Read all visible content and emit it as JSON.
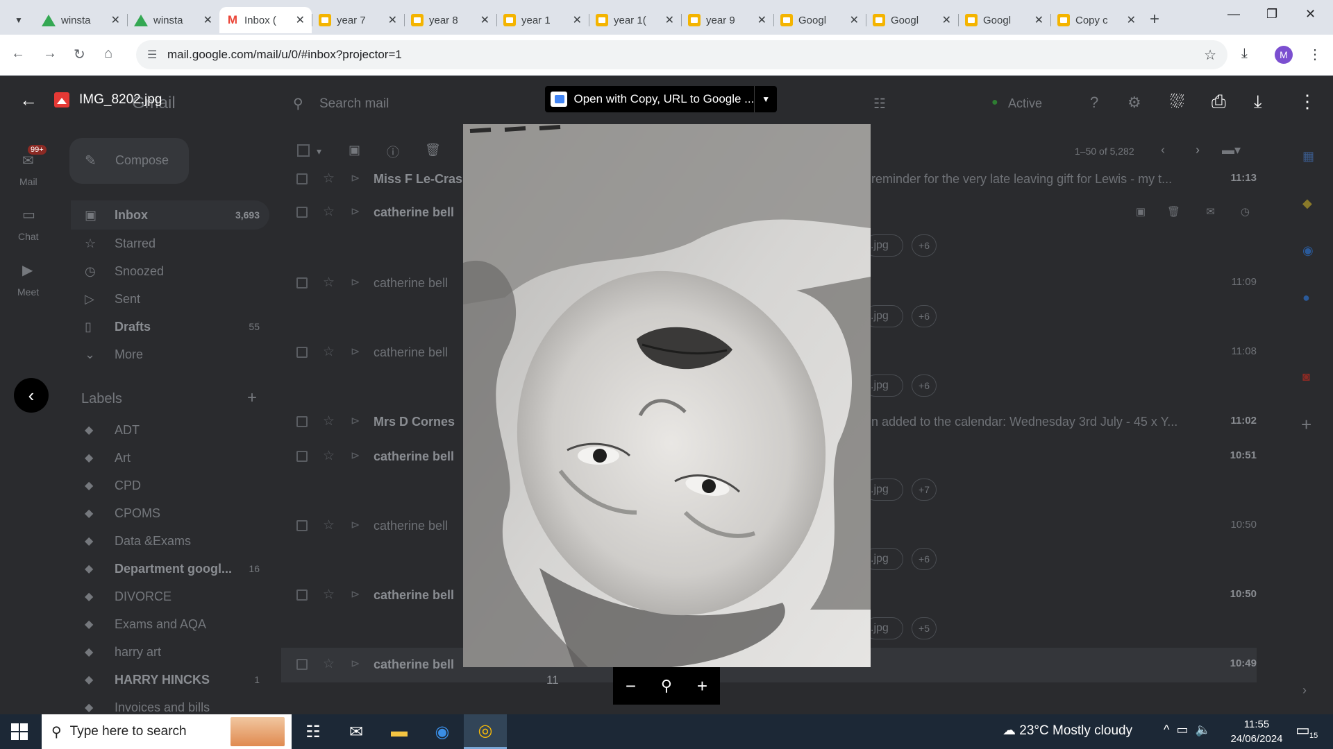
{
  "browser": {
    "tabs": [
      {
        "label": "winsta",
        "icon": "drive-icon",
        "active": false
      },
      {
        "label": "winsta",
        "icon": "drive-icon",
        "active": false
      },
      {
        "label": "Inbox (",
        "icon": "gmail-icon",
        "active": true
      },
      {
        "label": "year 7",
        "icon": "slides-icon",
        "active": false
      },
      {
        "label": "year 8",
        "icon": "slides-icon",
        "active": false
      },
      {
        "label": "year 1",
        "icon": "slides-icon",
        "active": false
      },
      {
        "label": "year 1(",
        "icon": "slides-icon",
        "active": false
      },
      {
        "label": "year 9",
        "icon": "slides-icon",
        "active": false
      },
      {
        "label": "Googl",
        "icon": "slides-icon",
        "active": false
      },
      {
        "label": "Googl",
        "icon": "slides-icon",
        "active": false
      },
      {
        "label": "Googl",
        "icon": "slides-icon",
        "active": false
      },
      {
        "label": "Copy c",
        "icon": "slides-icon",
        "active": false
      }
    ],
    "url": "mail.google.com/mail/u/0/#inbox?projector=1",
    "profile_initial": "M"
  },
  "viewer": {
    "file_name": "IMG_8202.jpg",
    "open_with_label": "Open with Copy, URL to Google ...",
    "page_number": "11"
  },
  "gmail": {
    "logo": "Gmail",
    "search_placeholder": "Search mail",
    "status": "Active",
    "pagination": "1–50 of 5,282",
    "compose": "Compose",
    "rail": [
      {
        "label": "Mail",
        "badge": "99+"
      },
      {
        "label": "Chat"
      },
      {
        "label": "Meet"
      }
    ],
    "nav": [
      {
        "label": "Inbox",
        "count": "3,693"
      },
      {
        "label": "Starred",
        "count": ""
      },
      {
        "label": "Snoozed",
        "count": ""
      },
      {
        "label": "Sent",
        "count": ""
      },
      {
        "label": "Drafts",
        "count": "55"
      },
      {
        "label": "More",
        "count": ""
      }
    ],
    "labels_header": "Labels",
    "labels": [
      {
        "label": "ADT",
        "count": ""
      },
      {
        "label": "Art",
        "count": ""
      },
      {
        "label": "CPD",
        "count": ""
      },
      {
        "label": "CPOMS",
        "count": ""
      },
      {
        "label": "Data &Exams",
        "count": ""
      },
      {
        "label": "Department googl...",
        "count": "16"
      },
      {
        "label": "DIVORCE",
        "count": ""
      },
      {
        "label": "Exams and AQA",
        "count": ""
      },
      {
        "label": "harry art",
        "count": ""
      },
      {
        "label": "HARRY HINCKS",
        "count": "1"
      },
      {
        "label": "Invoices and bills",
        "count": ""
      }
    ],
    "emails": [
      {
        "sender": "Miss F Le-Cras",
        "subject": "reminder for the very late leaving gift for Lewis - my t...",
        "time": "11:13",
        "unread": true,
        "chip": "",
        "more": ""
      },
      {
        "sender": "catherine bell",
        "subject": "",
        "time": "",
        "unread": true,
        "chip": ".jpg",
        "more": "+6"
      },
      {
        "sender": "catherine bell",
        "subject": "",
        "time": "11:09",
        "unread": false,
        "chip": ".jpg",
        "more": "+6"
      },
      {
        "sender": "catherine bell",
        "subject": "",
        "time": "11:08",
        "unread": false,
        "chip": ".jpg",
        "more": "+6"
      },
      {
        "sender": "Mrs D Cornes",
        "subject": "n added to the calendar: Wednesday 3rd July - 45 x Y...",
        "time": "11:02",
        "unread": true,
        "chip": "",
        "more": ""
      },
      {
        "sender": "catherine bell",
        "subject": "",
        "time": "10:51",
        "unread": true,
        "chip": ".jpg",
        "more": "+7"
      },
      {
        "sender": "catherine bell",
        "subject": "",
        "time": "10:50",
        "unread": false,
        "chip": ".jpg",
        "more": "+6"
      },
      {
        "sender": "catherine bell",
        "subject": "",
        "time": "10:50",
        "unread": true,
        "chip": ".jpg",
        "more": "+5"
      },
      {
        "sender": "catherine bell",
        "subject": "",
        "time": "10:49",
        "unread": true,
        "chip": "",
        "more": ""
      }
    ]
  },
  "taskbar": {
    "search_placeholder": "Type here to search",
    "weather": "23°C  Mostly cloudy",
    "time": "11:55",
    "date": "24/06/2024",
    "notifications": "15"
  }
}
